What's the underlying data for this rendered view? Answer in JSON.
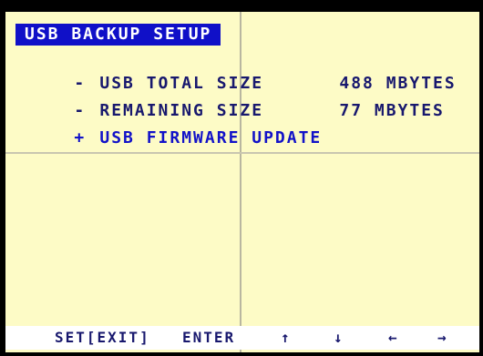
{
  "menu": {
    "title": "USB BACKUP SETUP",
    "items": [
      {
        "bullet": "-",
        "label": "USB TOTAL SIZE",
        "value": "488 MBYTES"
      },
      {
        "bullet": "-",
        "label": "REMAINING SIZE",
        "value": "77 MBYTES"
      },
      {
        "bullet": "+",
        "label": "USB FIRMWARE UPDATE",
        "value": ""
      }
    ]
  },
  "footer": {
    "set_exit": "SET[EXIT]",
    "enter": "ENTER",
    "up": "↑",
    "down": "↓",
    "left": "←",
    "right": "→"
  },
  "colors": {
    "background": "#fdfbc6",
    "title_bg": "#1010c8",
    "text": "#18186e",
    "selected_text": "#1212c8"
  }
}
